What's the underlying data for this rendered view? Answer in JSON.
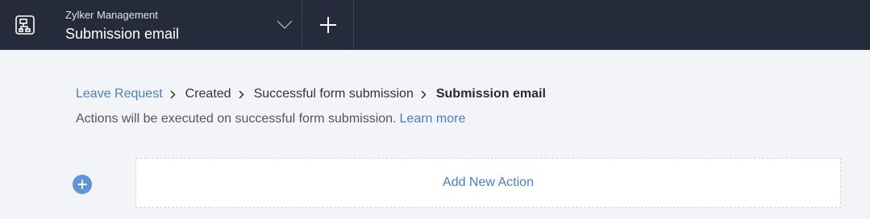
{
  "header": {
    "app_icon": "workflow-icon",
    "subtitle": "Zylker Management",
    "title": "Submission email",
    "dropdown_icon": "chevron-down-icon",
    "add_icon": "plus-icon"
  },
  "breadcrumb": {
    "items": [
      "Leave Request",
      "Created",
      "Successful form submission"
    ],
    "current": "Submission email",
    "separator_icon": "chevron-right-icon"
  },
  "info": {
    "text": "Actions will be executed on successful form submission.",
    "link": "Learn more"
  },
  "action": {
    "add_label": "Add New Action",
    "plus_icon": "plus-circle-icon"
  },
  "colors": {
    "header_bg": "#262b3b",
    "page_bg": "#f3f4f7",
    "link": "#4a7fc1",
    "accent_circle": "#5d95d6"
  }
}
